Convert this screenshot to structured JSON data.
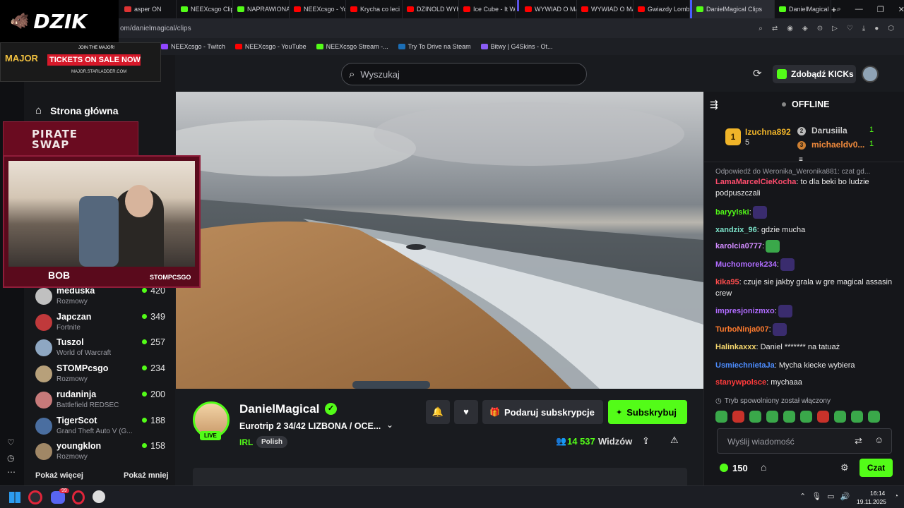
{
  "browser": {
    "tabs": [
      {
        "label": "asper ON",
        "color": "#d33"
      },
      {
        "label": "NEEXcsgo Clips",
        "color": "#53fc18"
      },
      {
        "label": "NAPRAWIONA",
        "color": "#53fc18"
      },
      {
        "label": "NEEXcsgo - YouT",
        "color": "#ff0000"
      },
      {
        "label": "Krycha co leci",
        "color": "#ff0000"
      },
      {
        "label": "DZINOLD WYKU",
        "color": "#ff0000"
      },
      {
        "label": "Ice Cube - It Wa",
        "color": "#ff0000"
      },
      {
        "label": "WYWIAD O MA",
        "color": "#ff0000"
      },
      {
        "label": "WYWIAD O MA",
        "color": "#ff0000"
      },
      {
        "label": "Gwiazdy Lomba",
        "color": "#ff0000"
      }
    ],
    "active_tab": "DanielMagical Clips",
    "last_tab": "DanielMagical St",
    "url": "om/danielmagical/clips",
    "bookmarks": [
      {
        "label": "NEEXcsgo - Twitch",
        "color": "#9146ff"
      },
      {
        "label": "NEEXcsgo - YouTube",
        "color": "#ff0000"
      },
      {
        "label": "NEEXcsgo Stream -...",
        "color": "#53fc18"
      },
      {
        "label": "Try To Drive na Steam",
        "color": "#1b6eb6"
      },
      {
        "label": "Bitwy | G4Skins - Ot...",
        "color": "#8a5cf6"
      }
    ]
  },
  "overlays": {
    "logo": "DZIK",
    "ad_small": "JOIN THE MAJOR!",
    "ad_title": "TICKETS ON SALE NOW",
    "ad_url": "MAJOR.STARLADDER.COM",
    "ad_badge": "MAJOR",
    "pirate": "PIRATE SWAP",
    "cam_tag": "STOMPCSGO",
    "cam_logo": "BOB"
  },
  "site": {
    "search_placeholder": "Wyszukaj",
    "kicks_label": "Zdobądź KICKs"
  },
  "sidebar": {
    "home_label": "Strona główna",
    "channels": [
      {
        "name": "meduska",
        "category": "Rozmowy",
        "viewers": "420",
        "color": "#c0c0c0"
      },
      {
        "name": "Japczan",
        "category": "Fortnite",
        "viewers": "349",
        "color": "#c0393b"
      },
      {
        "name": "Tuszol",
        "category": "World of Warcraft",
        "viewers": "257",
        "color": "#8ea7c2"
      },
      {
        "name": "STOMPcsgo",
        "category": "Rozmowy",
        "viewers": "234",
        "color": "#b7a07a"
      },
      {
        "name": "rudaninja",
        "category": "Battlefield REDSEC",
        "viewers": "200",
        "color": "#c77a7a"
      },
      {
        "name": "TigerScot",
        "category": "Grand Theft Auto V (G...",
        "viewers": "188",
        "color": "#4a6ea0"
      },
      {
        "name": "youngklon",
        "category": "Rozmowy",
        "viewers": "158",
        "color": "#a08766"
      }
    ],
    "show_more": "Pokaż więcej",
    "show_less": "Pokaż mniej"
  },
  "stream": {
    "streamer": "DanielMagical",
    "live_badge": "LIVE",
    "title": "Eurotrip 2 34/42 LIZBONA / OCE...",
    "category": "IRL",
    "language": "Polish",
    "gift_label": "Podaruj subskrypcje",
    "subscribe_label": "Subskrybuj",
    "viewers": "14 537",
    "viewers_label": "Widzów"
  },
  "chat": {
    "status": "OFFLINE",
    "leaderboard": [
      {
        "rank": "1",
        "name": "Izuchna892",
        "value": "5"
      },
      {
        "rank": "2",
        "name": "Darusiila",
        "value": "1"
      },
      {
        "rank": "3",
        "name": "michaeldv0...",
        "value": "1"
      }
    ],
    "reply": "Odpowiedź do Weronika_Weronika881: czat gd...",
    "messages": [
      {
        "user": "LamaMarcelCieKocha",
        "color": "#ff4d6d",
        "text": ": to dla beki bo ludzie podpuszczali"
      },
      {
        "user": "baryylski",
        "color": "#53fc18",
        "text": ":"
      },
      {
        "user": "xandzix_96",
        "color": "#7be1c8",
        "text": ": gdzie mucha"
      },
      {
        "user": "karolcia0777",
        "color": "#d28cff",
        "text": ":"
      },
      {
        "user": "Muchomorek234",
        "color": "#b06cff",
        "text": ":"
      },
      {
        "user": "kika95",
        "color": "#ff4d4d",
        "text": ": czuje sie jakby grala w gre magical assasin crew"
      },
      {
        "user": "impresjonizmxo",
        "color": "#b06cff",
        "text": ":"
      },
      {
        "user": "TurboNinja007",
        "color": "#ff7b2e",
        "text": ":"
      },
      {
        "user": "Halinkaxxx",
        "color": "#f5d76e",
        "text": ": Daniel ******* na tatuaż"
      },
      {
        "user": "UsmiechnietaJa",
        "color": "#4d8dff",
        "text": ": Mycha kiecke wybiera"
      },
      {
        "user": "stanywpolsce",
        "color": "#ff3b3b",
        "text": ": mychaaa"
      }
    ],
    "slow_mode": "Tryb spowolniony został włączony",
    "input_placeholder": "Wyślij wiadomość",
    "points": "150",
    "send_label": "Czat"
  },
  "taskbar": {
    "time": "16:14",
    "date": "19.11.2025",
    "badge": "99"
  }
}
